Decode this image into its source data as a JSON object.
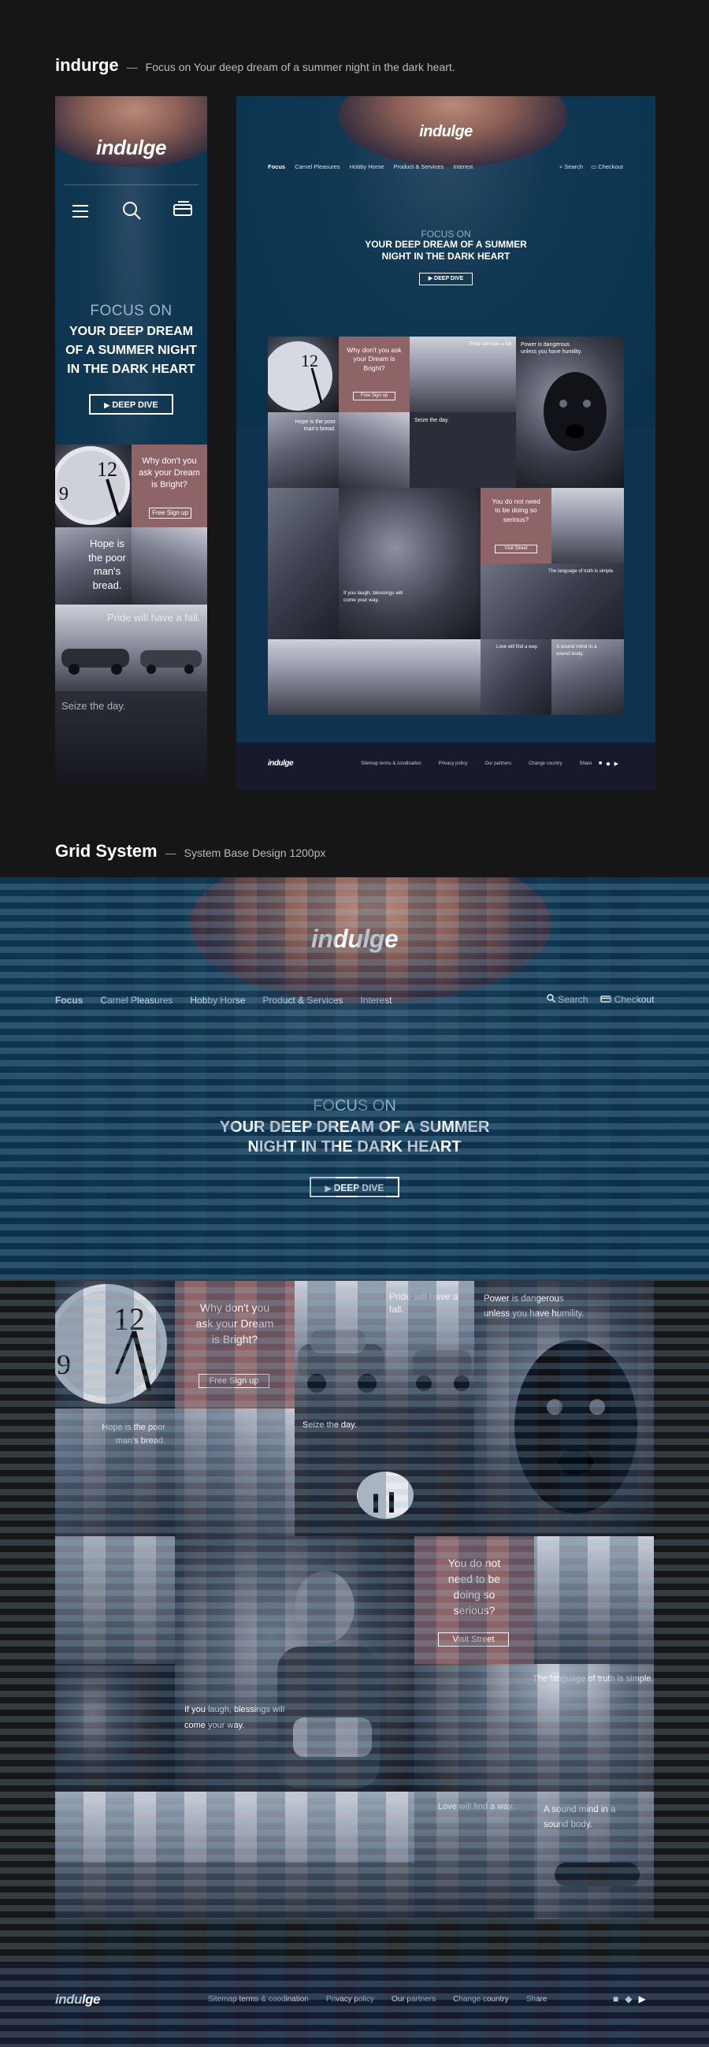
{
  "section1": {
    "brand": "indurge",
    "tagline": "Focus on Your deep dream of a summer night in the dark heart."
  },
  "section2": {
    "title": "Grid System",
    "subtitle": "System Base Design 1200px"
  },
  "site": {
    "logo": "indulge",
    "nav": [
      "Focus",
      "Carnel Pleasures",
      "Hobby Horse",
      "Product & Services",
      "Interest"
    ],
    "search_label": "Search",
    "checkout_label": "Checkout",
    "hero_kicker": "FOCUS ON",
    "hero_title_line1": "YOUR DEEP DREAM OF A SUMMER",
    "hero_title_line2": "NIGHT IN THE DARK HEART",
    "mobile_title_line1": "YOUR DEEP DREAM",
    "mobile_title_line2": "OF A SUMMER NIGHT",
    "mobile_title_line3": "IN THE DARK HEART",
    "cta_label": "DEEP DIVE",
    "tiles": {
      "why_question": "Why don't you ask your Dream is Bright?",
      "free_signup": "Free Sign up",
      "pride": "Pride will have a fall.",
      "power": "Power is dangerous unless you have humility.",
      "hope": "Hope is the poor man's bread.",
      "seize": "Seize the day.",
      "laugh": "If you laugh, blessings will come your way.",
      "serious": "You do not need to be doing so serious?",
      "visit_street": "Visit Street",
      "truth": "The language of truth is simple.",
      "love": "Love will find a way.",
      "sound": "A sound mind in a sound body."
    },
    "footer": {
      "logo": "indulge",
      "links": [
        "Sitemap terms & coodination",
        "Privacy policy",
        "Our partners",
        "Change country",
        "Share"
      ]
    }
  },
  "icons": [
    "hamburger-icon",
    "search-icon",
    "cart-icon",
    "play-icon",
    "facebook-icon",
    "twitter-icon",
    "youtube-icon"
  ],
  "colors": {
    "page_bg": "#161616",
    "hero_blue": "#0c3551",
    "rose_tile": "#8e6466",
    "footer_navy": "#17192c"
  }
}
